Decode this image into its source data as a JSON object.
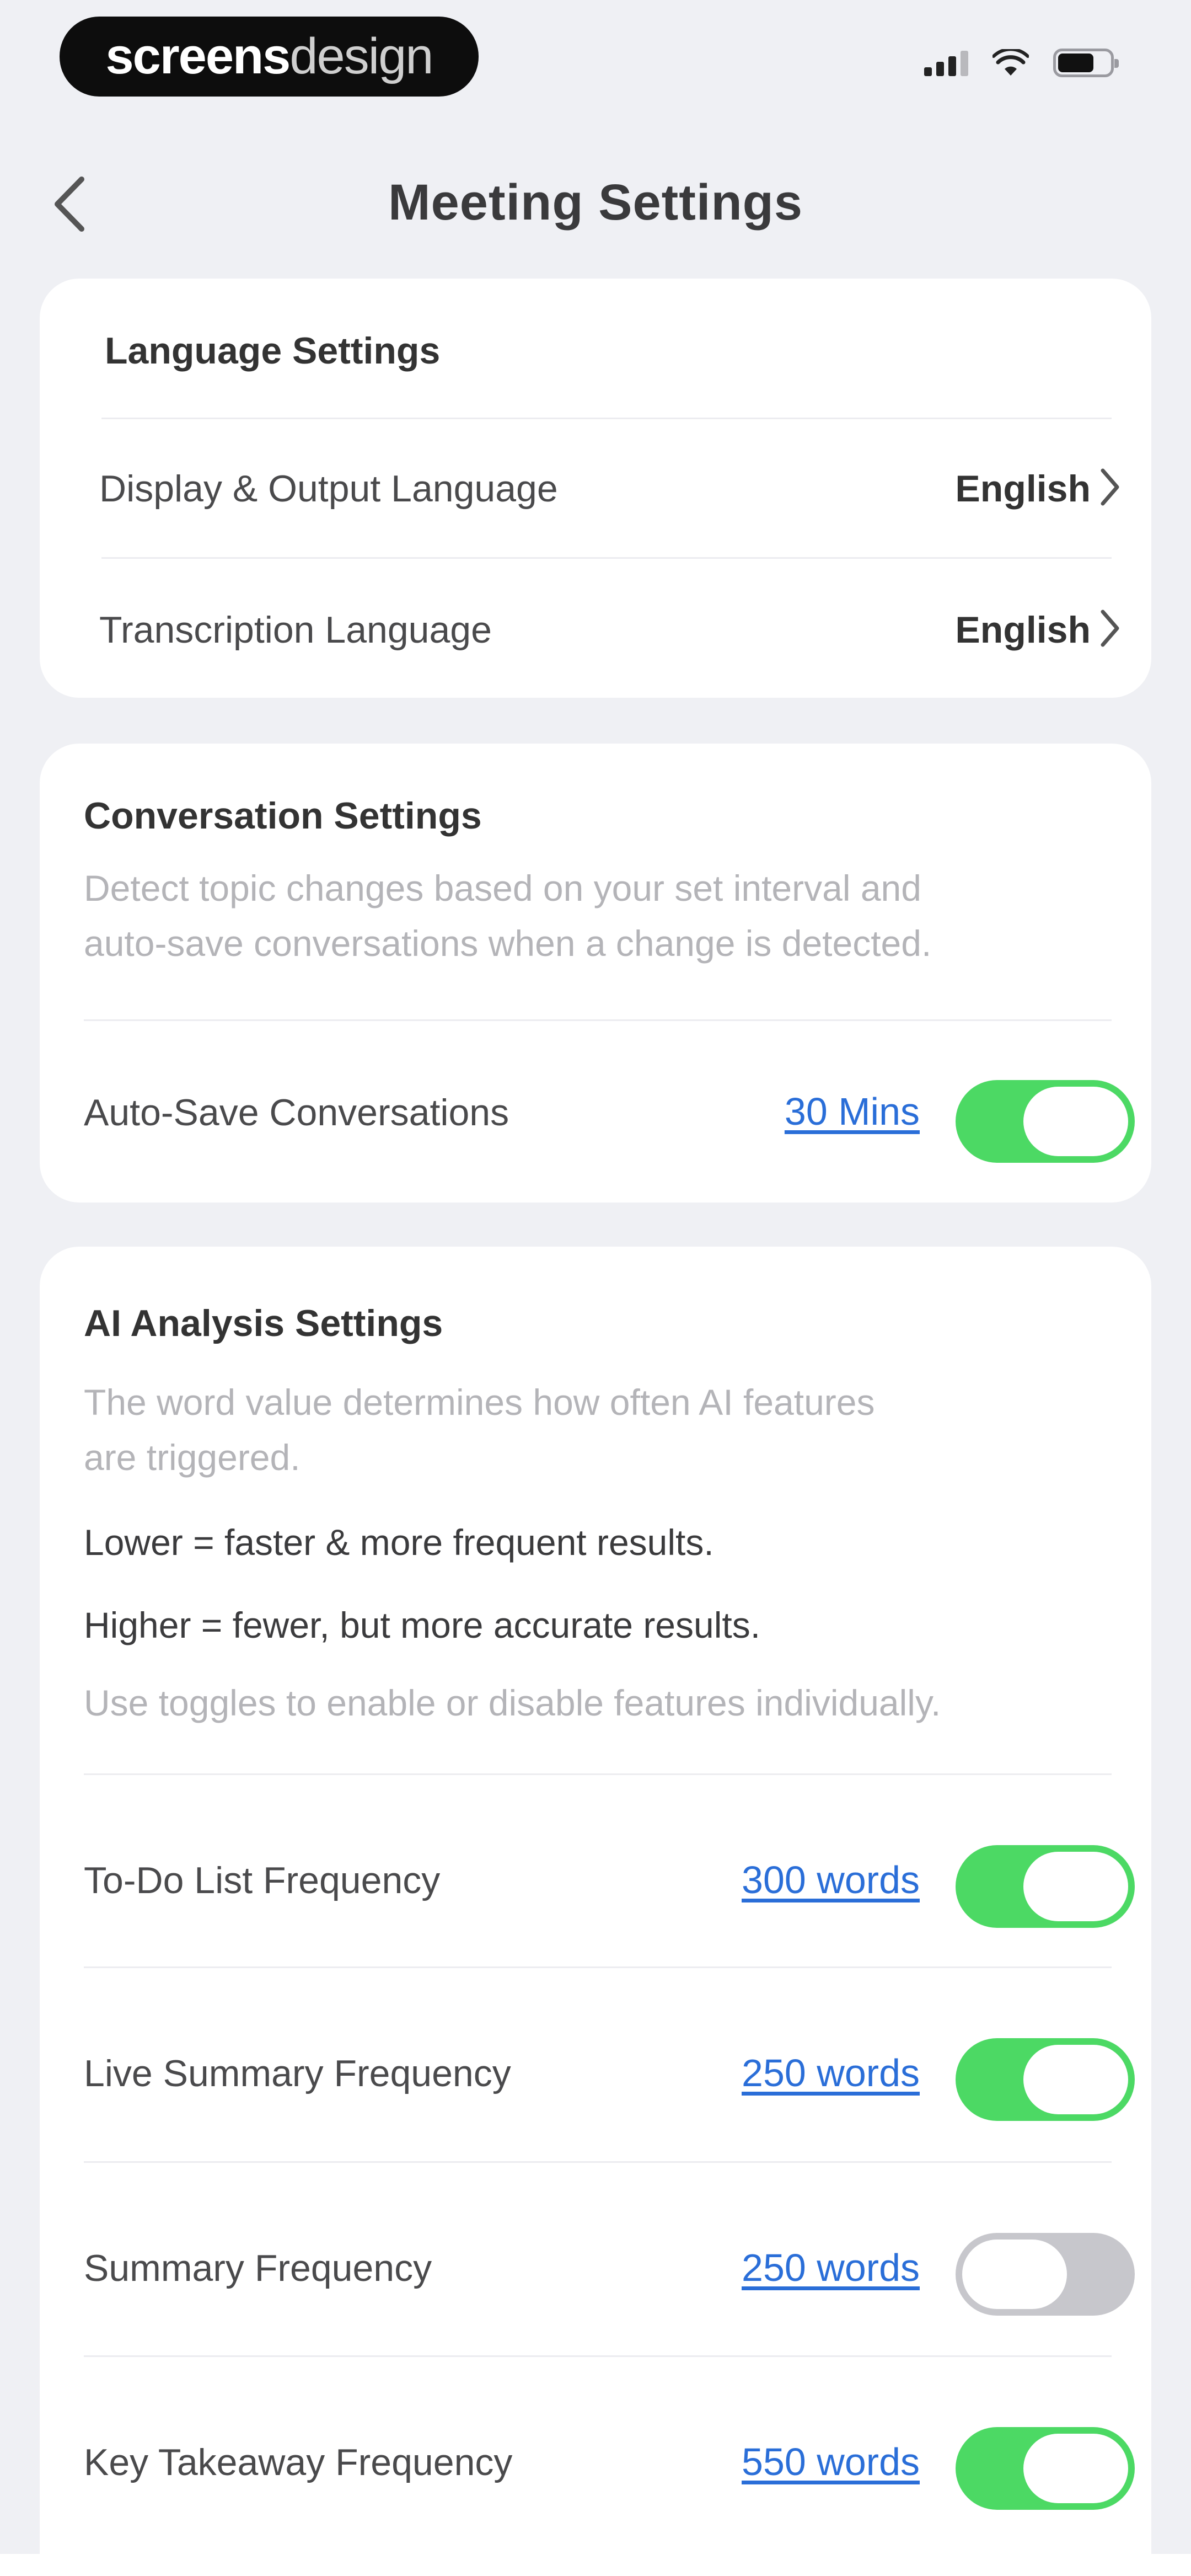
{
  "watermark": {
    "bold": "screens",
    "light": "design"
  },
  "status": {
    "signal_bars": 3,
    "battery_level": 0.7
  },
  "header": {
    "title": "Meeting Settings"
  },
  "language_settings": {
    "title": "Language Settings",
    "rows": [
      {
        "label": "Display & Output Language",
        "value": "English"
      },
      {
        "label": "Transcription Language",
        "value": "English"
      }
    ]
  },
  "conversation_settings": {
    "title": "Conversation Settings",
    "description_line1": "Detect topic changes based on your set interval and",
    "description_line2": "auto-save conversations when a change is detected.",
    "auto_save": {
      "label": "Auto-Save Conversations",
      "value": "30 Mins",
      "enabled": true
    }
  },
  "ai_analysis_settings": {
    "title": "AI Analysis Settings",
    "description_line1": "The word value determines how often AI features",
    "description_line2": "are triggered.",
    "lower_note": "Lower = faster & more frequent results.",
    "higher_note": "Higher = fewer, but more accurate results.",
    "toggle_note": "Use toggles to enable or disable features individually.",
    "rows": [
      {
        "label": "To-Do List Frequency",
        "value": "300 words",
        "enabled": true
      },
      {
        "label": "Live Summary Frequency",
        "value": "250 words",
        "enabled": true
      },
      {
        "label": "Summary Frequency",
        "value": "250 words",
        "enabled": false
      },
      {
        "label": "Key Takeaway Frequency",
        "value": "550 words",
        "enabled": true
      }
    ]
  },
  "colors": {
    "background": "#eff0f4",
    "toggle_on": "#4cd964",
    "toggle_off": "#c7c7cc",
    "link": "#2a6ed8"
  }
}
